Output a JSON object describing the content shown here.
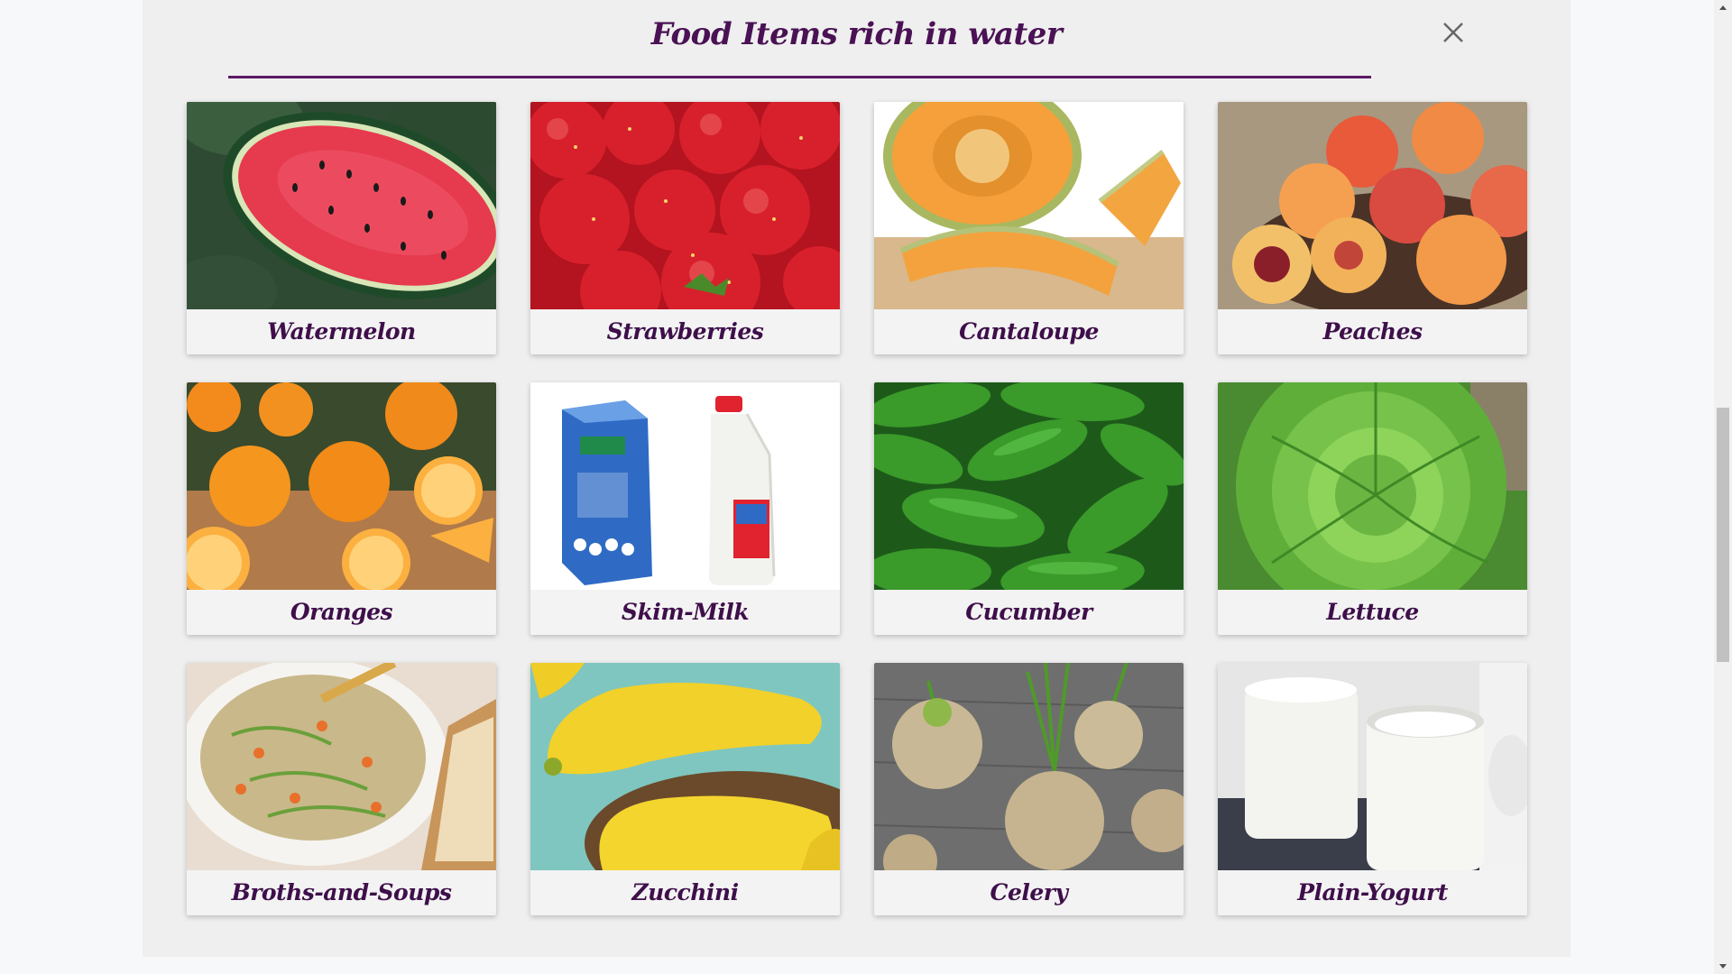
{
  "modal": {
    "title": "Food Items rich in water",
    "close_icon": "close-icon"
  },
  "items": [
    {
      "label": "Watermelon",
      "icon": "watermelon-image"
    },
    {
      "label": "Strawberries",
      "icon": "strawberries-image"
    },
    {
      "label": "Cantaloupe",
      "icon": "cantaloupe-image"
    },
    {
      "label": "Peaches",
      "icon": "peaches-image"
    },
    {
      "label": "Oranges",
      "icon": "oranges-image"
    },
    {
      "label": "Skim-Milk",
      "icon": "skim-milk-image"
    },
    {
      "label": "Cucumber",
      "icon": "cucumber-image"
    },
    {
      "label": "Lettuce",
      "icon": "lettuce-image"
    },
    {
      "label": "Broths-and-Soups",
      "icon": "broths-and-soups-image"
    },
    {
      "label": "Zucchini",
      "icon": "zucchini-image"
    },
    {
      "label": "Celery",
      "icon": "celery-image"
    },
    {
      "label": "Plain-Yogurt",
      "icon": "plain-yogurt-image"
    }
  ],
  "colors": {
    "title": "#4a1254",
    "label": "#3e0f4a",
    "rule": "#5b1a64",
    "modal_bg": "#efefef"
  }
}
